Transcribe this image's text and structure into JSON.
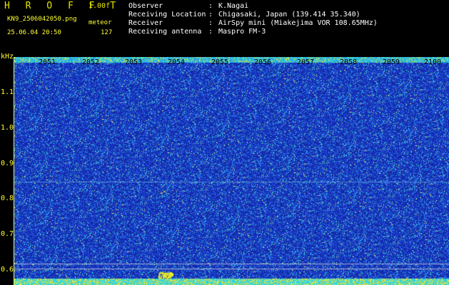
{
  "header": {
    "brand": "H R O F F T",
    "version": "1.00f",
    "filename": "KN9_2506042050.png",
    "mode": "meteor",
    "datetime": "25.06.04 20:50",
    "count": "127"
  },
  "info": [
    {
      "key": "Observer",
      "value": "K.Nagai"
    },
    {
      "key": "Receiving Location",
      "value": "Chigasaki, Japan (139.414 35.340)"
    },
    {
      "key": "Receiver",
      "value": "AirSpy mini (Miakejima VOR 108.65MHz)"
    },
    {
      "key": "Receiving antenna",
      "value": "Maspro FM-3"
    }
  ],
  "axis": {
    "unit": "kHz",
    "y_labels": [
      "1.1",
      "1.0",
      "0.9",
      "0.8",
      "0.7",
      "0.6"
    ],
    "x_labels": [
      "2051",
      "2052",
      "2053",
      "2054",
      "2055",
      "2056",
      "2057",
      "2058",
      "2059",
      "2100"
    ]
  },
  "colors": {
    "background": "#000000",
    "label": "#ffff33",
    "spectrogram_base": "#1a2fa8"
  }
}
